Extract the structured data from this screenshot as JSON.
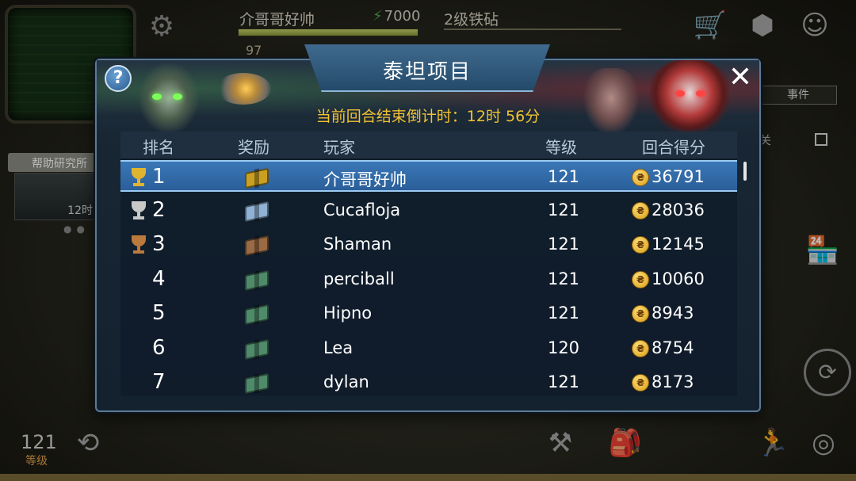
{
  "hud": {
    "player_name": "介哥哥好帅",
    "xp_value": "7000",
    "sub_value": "97",
    "level_name": "2级铁砧",
    "help_research": "帮助研究所",
    "research_timer": "12时",
    "player_level": "121",
    "player_level_label": "等级",
    "events_tab": "事件",
    "side_text": "关",
    "icons": [
      "settings-gear",
      "shopping-cart",
      "cube",
      "robot-face",
      "shop-building",
      "refresh",
      "anvil",
      "backpack",
      "running-man",
      "target"
    ]
  },
  "modal": {
    "title": "泰坦项目",
    "countdown": "当前回合结束倒计时：12时 56分",
    "help_label": "?",
    "close_label": "✕",
    "columns": {
      "rank": "排名",
      "reward": "奖励",
      "player": "玩家",
      "level": "等级",
      "score": "回合得分"
    },
    "rows": [
      {
        "rank": "1",
        "player": "介哥哥好帅",
        "level": "121",
        "score": "36791",
        "trophy": "gold",
        "crate": "gold",
        "selected": true
      },
      {
        "rank": "2",
        "player": "Cucafloja",
        "level": "121",
        "score": "28036",
        "trophy": "silver",
        "crate": "silver",
        "selected": false
      },
      {
        "rank": "3",
        "player": "Shaman",
        "level": "121",
        "score": "12145",
        "trophy": "bronze",
        "crate": "bronze",
        "selected": false
      },
      {
        "rank": "4",
        "player": "perciball",
        "level": "121",
        "score": "10060",
        "trophy": "",
        "crate": "green",
        "selected": false
      },
      {
        "rank": "5",
        "player": "Hipno",
        "level": "121",
        "score": "8943",
        "trophy": "",
        "crate": "green",
        "selected": false
      },
      {
        "rank": "6",
        "player": "Lea",
        "level": "120",
        "score": "8754",
        "trophy": "",
        "crate": "green",
        "selected": false
      },
      {
        "rank": "7",
        "player": "dylan",
        "level": "121",
        "score": "8173",
        "trophy": "",
        "crate": "green",
        "selected": false
      }
    ]
  },
  "colors": {
    "gold": "#e0b431",
    "silver": "#c8c8c8",
    "bronze": "#b97a3c",
    "crate_gold": "#c9a021",
    "crate_silver": "#8fb2d4",
    "crate_bronze": "#9a6a44",
    "crate_green": "#4f8a6a",
    "accent": "#f2c230"
  }
}
